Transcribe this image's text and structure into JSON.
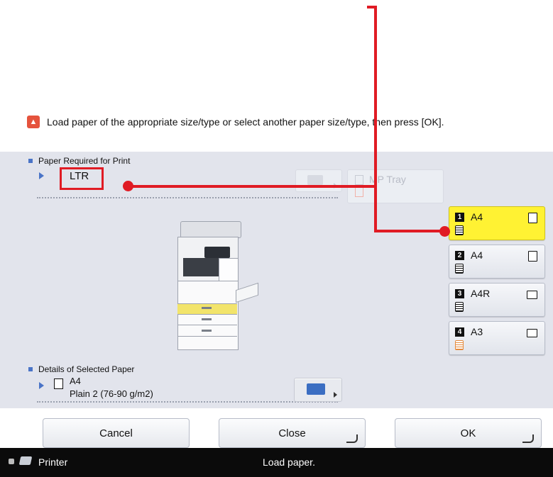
{
  "instruction": {
    "text": "Load paper of the appropriate size/type or select another paper size/type, then press [OK]."
  },
  "paper_required": {
    "label": "Paper Required for Print",
    "value": "LTR"
  },
  "mp_tray": {
    "label": "MP Tray"
  },
  "sources": [
    {
      "num": "1",
      "size": "A4",
      "orientation": "portrait",
      "selected": true
    },
    {
      "num": "2",
      "size": "A4",
      "orientation": "portrait",
      "selected": false
    },
    {
      "num": "3",
      "size": "A4R",
      "orientation": "landscape",
      "selected": false
    },
    {
      "num": "4",
      "size": "A3",
      "orientation": "landscape",
      "selected": false
    }
  ],
  "details": {
    "label": "Details of Selected Paper",
    "size": "A4",
    "type": "Plain 2 (76-90 g/m2)"
  },
  "buttons": {
    "cancel": "Cancel",
    "close": "Close",
    "ok": "OK"
  },
  "statusbar": {
    "app": "Printer",
    "message": "Load paper."
  },
  "colors": {
    "selected_source": "#fff233",
    "annotation": "#e01b24",
    "accent": "#4a74c7"
  }
}
